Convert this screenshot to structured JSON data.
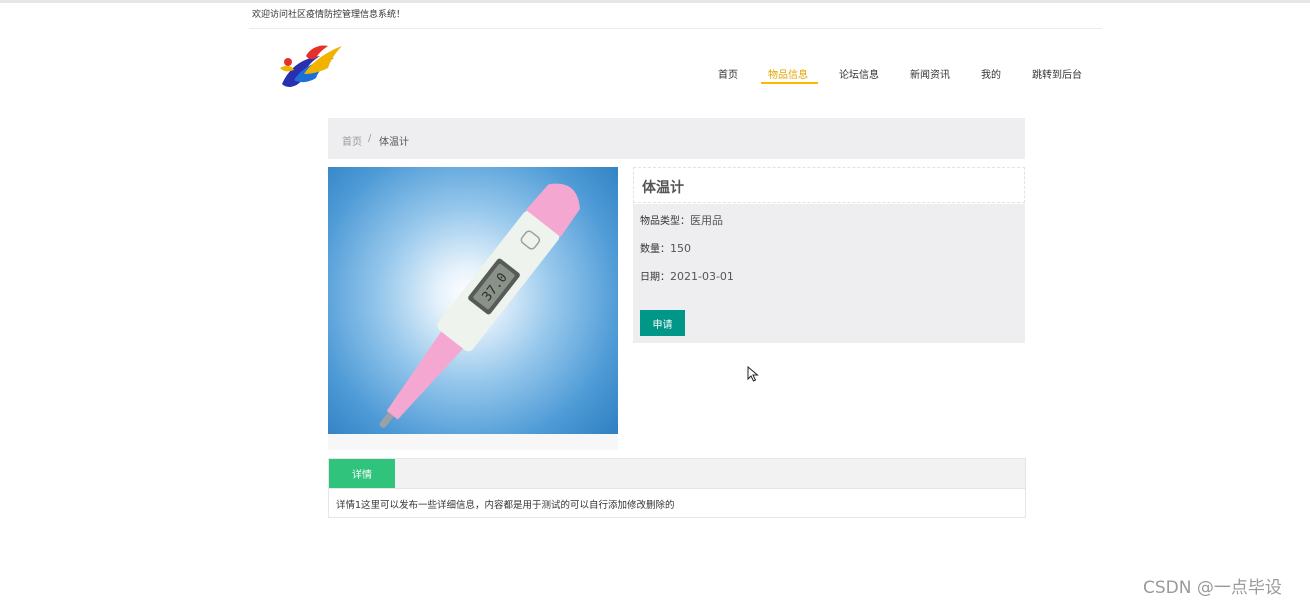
{
  "header": {
    "welcome": "欢迎访问社区疫情防控管理信息系统！"
  },
  "nav": {
    "items": [
      {
        "label": "首页",
        "active": false
      },
      {
        "label": "物品信息",
        "active": true
      },
      {
        "label": "论坛信息",
        "active": false
      },
      {
        "label": "新闻资讯",
        "active": false
      },
      {
        "label": "我的",
        "active": false
      },
      {
        "label": "跳转到后台",
        "active": false
      }
    ],
    "active_color": "#ffb800"
  },
  "breadcrumb": {
    "home": "首页",
    "separator": "/",
    "current": "体温计"
  },
  "product": {
    "name": "体温计",
    "type_label": "物品类型：",
    "type_value": "医用品",
    "quantity_label": "数量：",
    "quantity_value": "150",
    "date_label": "日期：",
    "date_value": "2021-03-01",
    "apply_button": "申请",
    "photo_icon": "thermometer-photo"
  },
  "tabs": {
    "items": [
      {
        "label": "详情",
        "active": true
      }
    ],
    "content": "详情1这里可以发布一些详细信息，内容都是用于测试的可以自行添加修改删除的"
  },
  "watermark": "CSDN @一点毕设",
  "colors": {
    "primary_button": "#009688",
    "tab_active": "#2fc37b",
    "panel_bg": "#eeeef0"
  }
}
